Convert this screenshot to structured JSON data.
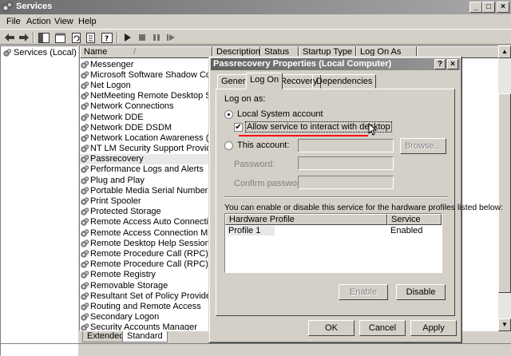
{
  "window": {
    "title": "Services",
    "min_label": "_",
    "max_label": "□",
    "close_label": "×"
  },
  "menu": [
    "File",
    "Action",
    "View",
    "Help"
  ],
  "tree": {
    "root": "Services (Local)"
  },
  "list": {
    "columns": [
      "Name",
      "Description",
      "Status",
      "Startup Type",
      "Log On As"
    ],
    "sort_indicator": "/",
    "rows": [
      "Messenger",
      "Microsoft Software Shadow Copy Pr...",
      "Net Logon",
      "NetMeeting Remote Desktop Sharing",
      "Network Connections",
      "Network DDE",
      "Network DDE DSDM",
      "Network Location Awareness (NLA)",
      "NT LM Security Support Provider",
      "Passrecovery",
      "Performance Logs and Alerts",
      "Plug and Play",
      "Portable Media Serial Number Service",
      "Print Spooler",
      "Protected Storage",
      "Remote Access Auto Connection Ma...",
      "Remote Access Connection Manager",
      "Remote Desktop Help Session Manager",
      "Remote Procedure Call (RPC)",
      "Remote Procedure Call (RPC) Locator",
      "Remote Registry",
      "Removable Storage",
      "Resultant Set of Policy Provider",
      "Routing and Remote Access",
      "Secondary Logon",
      "Security Accounts Manager"
    ],
    "selected_index": 9
  },
  "bottom_tabs": [
    "Extended",
    "Standard"
  ],
  "dialog": {
    "title": "Passrecovery Properties (Local Computer)",
    "help_label": "?",
    "close_label": "×",
    "tabs": [
      "General",
      "Log On",
      "Recovery",
      "Dependencies"
    ],
    "active_tab": 1,
    "log_on_as": "Log on as:",
    "local_system": "Local System account",
    "allow_interact": "Allow service to interact with desktop",
    "allow_interact_checked": true,
    "this_account": "This account:",
    "this_account_value": "",
    "browse": "Browse...",
    "password": "Password:",
    "confirm_password": "Confirm password:",
    "hw_note": "You can enable or disable this service for the hardware profiles listed below:",
    "hw_columns": [
      "Hardware Profile",
      "Service"
    ],
    "hw_rows": [
      {
        "profile": "Profile 1",
        "service": "Enabled"
      }
    ],
    "enable": "Enable",
    "disable": "Disable",
    "ok": "OK",
    "cancel": "Cancel",
    "apply": "Apply",
    "highlight_color": "#ff0000"
  }
}
